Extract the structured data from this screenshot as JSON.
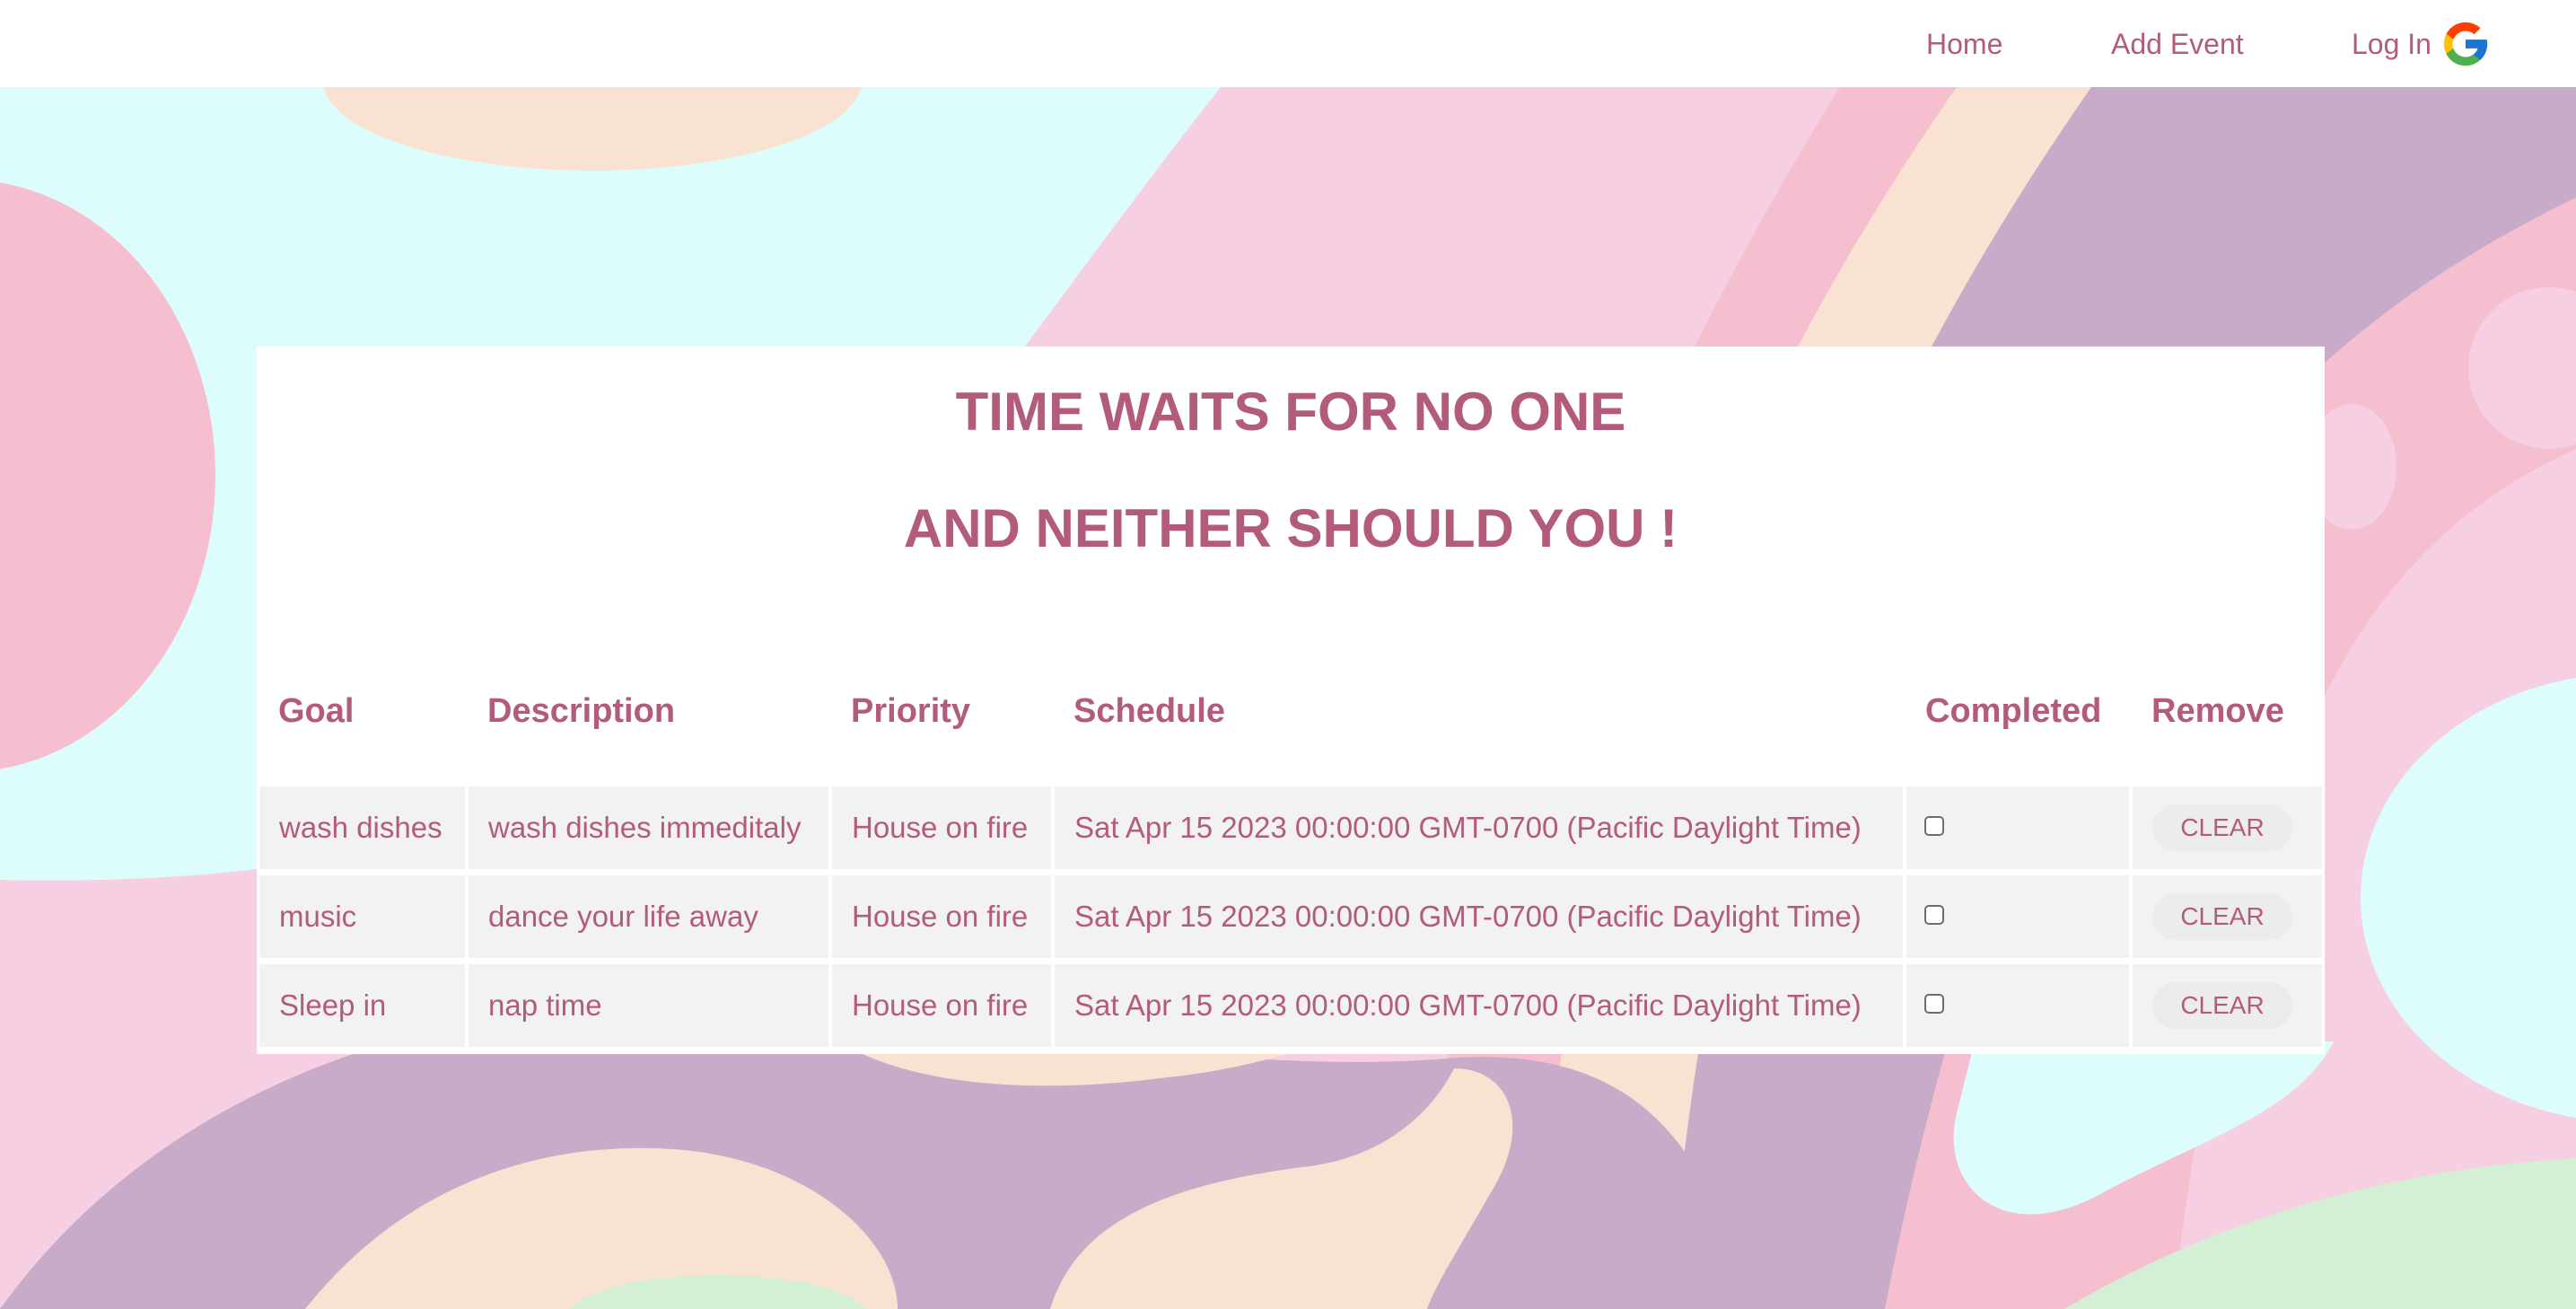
{
  "nav": {
    "home": "Home",
    "add_event": "Add Event",
    "login": "Log In",
    "login_icon": "google-icon"
  },
  "colors": {
    "accent": "#b35b7c",
    "card": "#ffffff",
    "row_bg": "#f2f2f2",
    "bg_cyan": "#dcfdfc",
    "bg_pink": "#f5bfcf",
    "bg_lightpink": "#f6cfe2",
    "bg_peach": "#f9e2d1",
    "bg_purple": "#c8abc9",
    "bg_green": "#d4f0d4"
  },
  "main": {
    "heading_line1": "TIME WAITS FOR NO ONE",
    "heading_line2": "AND NEITHER SHOULD YOU !",
    "columns": [
      "Goal",
      "Description",
      "Priority",
      "Schedule",
      "Completed",
      "Remove"
    ],
    "rows": [
      {
        "goal": "wash dishes",
        "description": "wash dishes immeditaly",
        "priority": "House on fire",
        "schedule": "Sat Apr 15 2023 00:00:00 GMT-0700 (Pacific Daylight Time)",
        "completed": false,
        "remove_label": "CLEAR"
      },
      {
        "goal": "music",
        "description": "dance your life away",
        "priority": "House on fire",
        "schedule": "Sat Apr 15 2023 00:00:00 GMT-0700 (Pacific Daylight Time)",
        "completed": false,
        "remove_label": "CLEAR"
      },
      {
        "goal": "Sleep in",
        "description": "nap time",
        "priority": "House on fire",
        "schedule": "Sat Apr 15 2023 00:00:00 GMT-0700 (Pacific Daylight Time)",
        "completed": false,
        "remove_label": "CLEAR"
      }
    ]
  }
}
